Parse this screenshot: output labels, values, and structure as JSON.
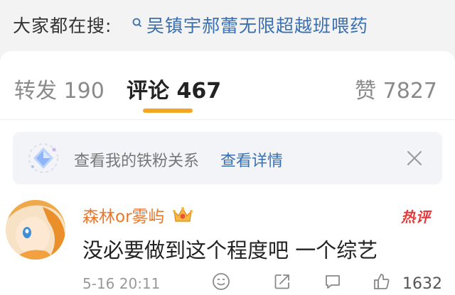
{
  "trending": {
    "label": "大家都在搜:",
    "query": "吴镇宇郝蕾无限超越班喂药"
  },
  "tabs": {
    "repost": "转发 190",
    "comment": "评论 467",
    "like": "赞 7827"
  },
  "fans_banner": {
    "text": "查看我的铁粉关系",
    "link": "查看详情"
  },
  "comment": {
    "username": "森林or雾屿",
    "badge": "热评",
    "text": "没必要做到这个程度吧 一个综艺",
    "timestamp": "5-16 20:11",
    "like_count": "1632"
  },
  "colors": {
    "accent": "#f5a623",
    "link": "#3a6fb0",
    "username": "#e8782c",
    "hot": "#e6393c"
  }
}
